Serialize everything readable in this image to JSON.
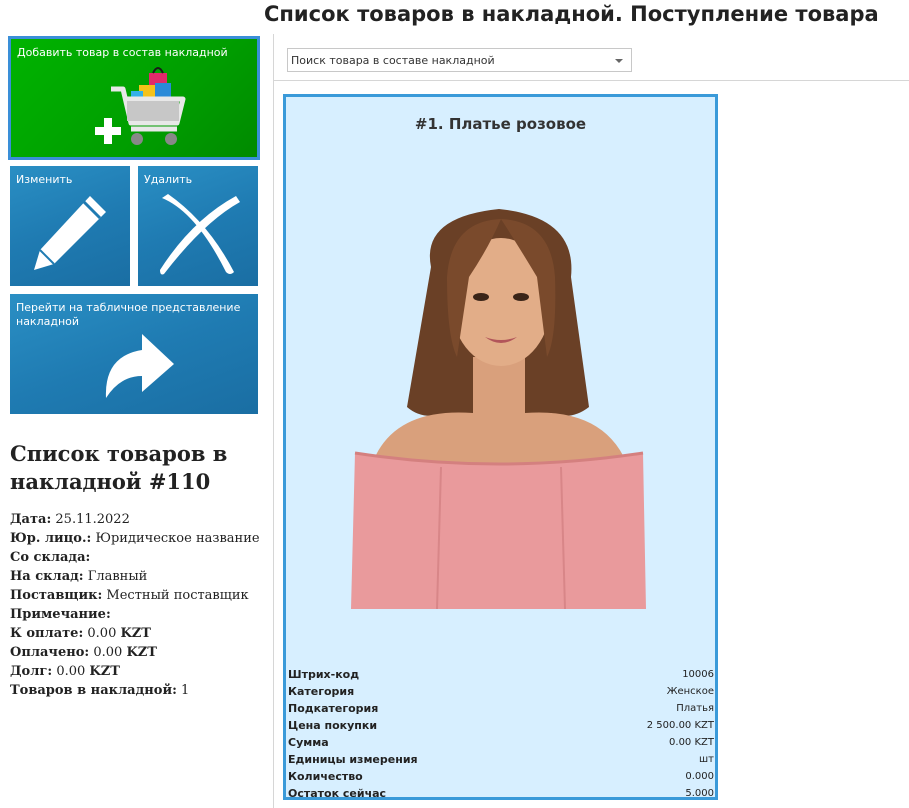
{
  "window": {
    "title": "Список товаров в накладной. Поступление товара"
  },
  "actions": {
    "add_label": "Добавить товар в состав накладной",
    "edit_label": "Изменить",
    "delete_label": "Удалить",
    "table_view_label": "Перейти на табличное представление накладной"
  },
  "invoice": {
    "title": "Список товаров в накладной #110",
    "date_label": "Дата:",
    "date": "25.11.2022",
    "legal_label": "Юр. лицо.:",
    "legal": "Юридическое название",
    "from_label": "Со склада:",
    "from": "",
    "to_label": "На склад:",
    "to": "Главный",
    "supplier_label": "Поставщик:",
    "supplier": "Местный поставщик",
    "note_label": "Примечание:",
    "note": "",
    "to_pay_label": "К оплате:",
    "to_pay": "0.00",
    "to_pay_cur": "KZT",
    "paid_label": "Оплачено:",
    "paid": "0.00",
    "paid_cur": "KZT",
    "debt_label": "Долг:",
    "debt": "0.00",
    "debt_cur": "KZT",
    "count_label": "Товаров в накладной:",
    "count": "1"
  },
  "search": {
    "placeholder": "Поиск товара в составе накладной"
  },
  "product": {
    "title": "#1. Платье розовое",
    "props": [
      {
        "key": "Штрих-код",
        "value": "10006"
      },
      {
        "key": "Категория",
        "value": "Женское"
      },
      {
        "key": "Подкатегория",
        "value": "Платья"
      },
      {
        "key": "Цена покупки",
        "value": "2 500.00 KZT"
      },
      {
        "key": "Сумма",
        "value": "0.00 KZT"
      },
      {
        "key": "Единицы измерения",
        "value": "шт"
      },
      {
        "key": "Количество",
        "value": "0.000"
      },
      {
        "key": "Остаток сейчас",
        "value": "5.000"
      }
    ]
  },
  "icons": {
    "add": "cart-plus-icon",
    "edit": "pencil-icon",
    "delete": "cross-icon",
    "table": "arrow-icon"
  },
  "colors": {
    "add_tile": "#00a800",
    "tile_blue": "#1f7bb2",
    "card_bg": "#d7efff",
    "card_border": "#3a9ad9"
  }
}
